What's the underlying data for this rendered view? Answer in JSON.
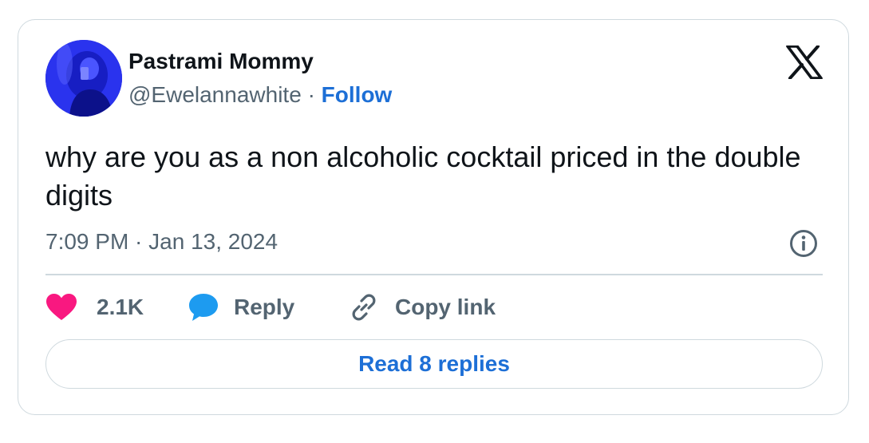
{
  "author": {
    "name": "Pastrami Mommy",
    "handle": "@Ewelannawhite",
    "separator": "·",
    "follow_label": "Follow"
  },
  "tweet": {
    "text": "why are you as a non alcoholic cocktail priced in the double digits",
    "timestamp": "7:09 PM · Jan 13, 2024"
  },
  "actions": {
    "likes": "2.1K",
    "reply_label": "Reply",
    "copy_link_label": "Copy link"
  },
  "read_replies_label": "Read 8 replies",
  "icons": {
    "logo": "x-logo-icon",
    "info": "info-icon",
    "like": "heart-icon",
    "reply": "speech-bubble-icon",
    "link": "link-icon"
  },
  "colors": {
    "link_blue": "#1d6fd6",
    "heart_pink": "#f91880",
    "reply_blue": "#1d9bf0",
    "muted_gray": "#536471",
    "border": "#cfd9de"
  }
}
